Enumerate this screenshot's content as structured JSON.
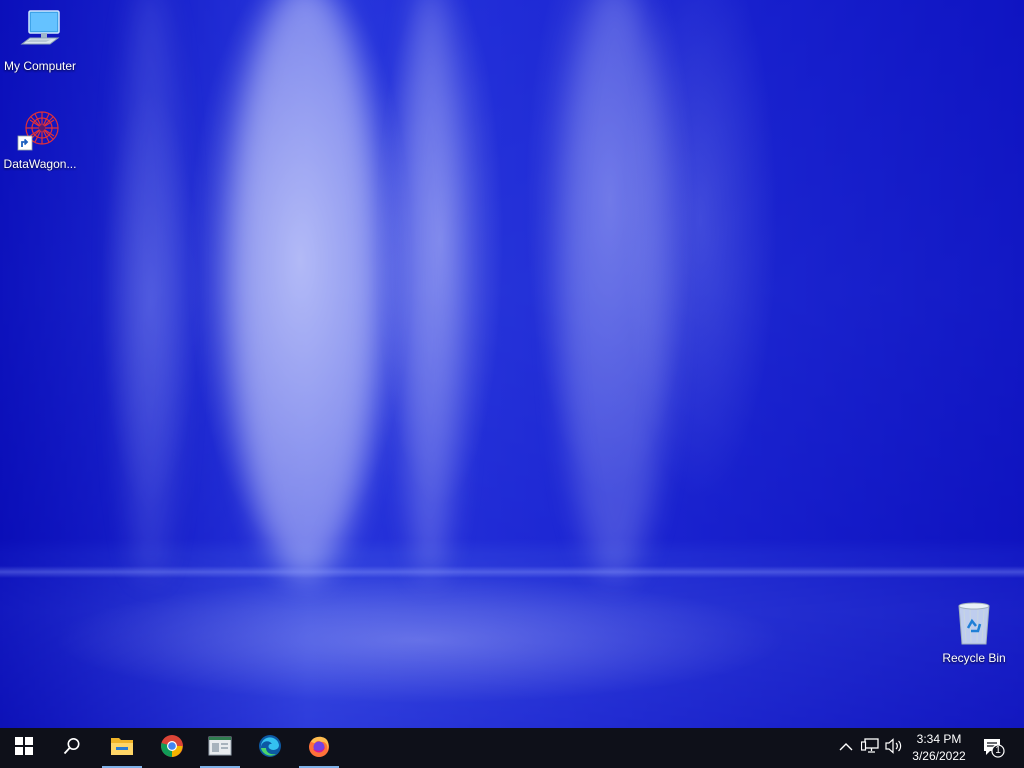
{
  "desktop": {
    "icons": [
      {
        "label": "My Computer",
        "icon": "computer-icon"
      },
      {
        "label": "DataWagon...",
        "icon": "datawagon-shortcut-icon"
      },
      {
        "label": "Recycle Bin",
        "icon": "recycle-bin-icon"
      }
    ]
  },
  "taskbar": {
    "start": {
      "icon": "windows-logo-icon"
    },
    "search": {
      "icon": "search-icon"
    },
    "pinned": [
      {
        "name": "File Explorer",
        "icon": "file-explorer-icon",
        "active": true
      },
      {
        "name": "Google Chrome",
        "icon": "chrome-icon",
        "active": false
      },
      {
        "name": "Application window",
        "icon": "app-window-icon",
        "active": true
      },
      {
        "name": "Microsoft Edge",
        "icon": "edge-icon",
        "active": false
      },
      {
        "name": "Firefox",
        "icon": "firefox-icon",
        "active": true
      }
    ],
    "tray": {
      "icons": [
        "chevron-up-icon",
        "network-icon",
        "volume-icon"
      ],
      "time": "3:34 PM",
      "date": "3/26/2022",
      "notifications": {
        "icon": "action-center-icon",
        "count": "1"
      }
    }
  },
  "colors": {
    "taskbar_bg": "#0e1019",
    "active_indicator": "#7fb1e8",
    "wallpaper_base": "#2c35c0"
  }
}
